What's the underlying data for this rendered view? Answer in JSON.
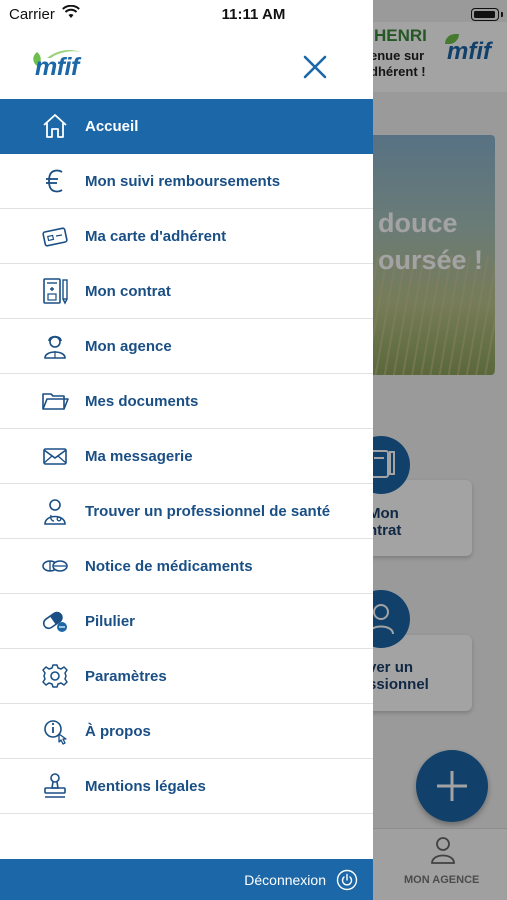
{
  "status_bar": {
    "carrier": "Carrier",
    "time": "11:11 AM"
  },
  "drawer": {
    "logo_text": "mfif",
    "items": [
      {
        "label": "Accueil",
        "icon": "home-icon",
        "active": true
      },
      {
        "label": "Mon suivi remboursements",
        "icon": "euro-icon"
      },
      {
        "label": "Ma carte d'adhérent",
        "icon": "card-icon"
      },
      {
        "label": "Mon contrat",
        "icon": "contract-icon"
      },
      {
        "label": "Mon agence",
        "icon": "agent-icon"
      },
      {
        "label": "Mes documents",
        "icon": "folder-icon"
      },
      {
        "label": "Ma messagerie",
        "icon": "envelope-icon"
      },
      {
        "label": "Trouver un professionnel de santé",
        "icon": "doctor-icon"
      },
      {
        "label": "Notice de médicaments",
        "icon": "pills-icon"
      },
      {
        "label": "Pilulier",
        "icon": "capsule-icon"
      },
      {
        "label": "Paramètres",
        "icon": "gear-icon"
      },
      {
        "label": "À propos",
        "icon": "info-icon"
      },
      {
        "label": "Mentions légales",
        "icon": "stamp-icon"
      }
    ],
    "logout_label": "Déconnexion"
  },
  "background": {
    "user_name": "HENRI",
    "welcome_line1": "enue sur",
    "welcome_line2": "dhérent !",
    "logo_text": "mfif",
    "banner_line1": "douce",
    "banner_line2": "oursée !",
    "card_contrat_line1": "Mon",
    "card_contrat_line2": "ntrat",
    "card_pro_line1": "ver un",
    "card_pro_line2": "ssionnel",
    "tab_label": "MON AGENCE"
  },
  "colors": {
    "primary": "#1c67a8",
    "text_blue": "#1a4f85",
    "leaf_green": "#6cbf4a"
  }
}
